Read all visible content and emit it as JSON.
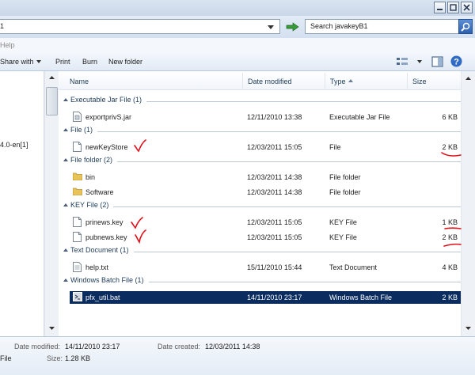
{
  "address": {
    "path_fragment": "1"
  },
  "search": {
    "text": "Search javakeyB1"
  },
  "menu": {
    "help_label": "Help"
  },
  "toolbar": {
    "share_label": "Share with",
    "print_label": "Print",
    "burn_label": "Burn",
    "new_folder_label": "New folder"
  },
  "nav": {
    "visible_item": "4.0-en[1]"
  },
  "columns": {
    "name": "Name",
    "date": "Date modified",
    "type": "Type",
    "size": "Size"
  },
  "groups": [
    {
      "title": "Executable Jar File (1)",
      "files": [
        {
          "name": "exportprivS.jar",
          "date": "12/11/2010 13:38",
          "type": "Executable Jar File",
          "size": "6 KB",
          "icon": "jar-file-icon"
        }
      ]
    },
    {
      "title": "File (1)",
      "files": [
        {
          "name": "newKeyStore",
          "date": "12/03/2011 15:05",
          "type": "File",
          "size": "2 KB",
          "icon": "blank-file-icon"
        }
      ]
    },
    {
      "title": "File folder (2)",
      "files": [
        {
          "name": "bin",
          "date": "12/03/2011 14:38",
          "type": "File folder",
          "size": "",
          "icon": "folder-icon"
        },
        {
          "name": "Software",
          "date": "12/03/2011 14:38",
          "type": "File folder",
          "size": "",
          "icon": "folder-icon"
        }
      ]
    },
    {
      "title": "KEY File (2)",
      "files": [
        {
          "name": "prinews.key",
          "date": "12/03/2011 15:05",
          "type": "KEY File",
          "size": "1 KB",
          "icon": "blank-file-icon"
        },
        {
          "name": "pubnews.key",
          "date": "12/03/2011 15:05",
          "type": "KEY File",
          "size": "2 KB",
          "icon": "blank-file-icon"
        }
      ]
    },
    {
      "title": "Text Document (1)",
      "files": [
        {
          "name": "help.txt",
          "date": "15/11/2010 15:44",
          "type": "Text Document",
          "size": "4 KB",
          "icon": "text-file-icon"
        }
      ]
    },
    {
      "title": "Windows Batch File (1)",
      "files": [
        {
          "name": "pfx_util.bat",
          "date": "14/11/2010 23:17",
          "type": "Windows Batch File",
          "size": "2 KB",
          "icon": "batch-file-icon",
          "selected": true
        }
      ]
    }
  ],
  "details": {
    "date_modified_label": "Date modified:",
    "date_modified_value": "14/11/2010 23:17",
    "date_created_label": "Date created:",
    "date_created_value": "12/03/2011 14:38",
    "type_value": "File",
    "size_label": "Size:",
    "size_value": "1.28 KB"
  },
  "colors": {
    "annotation": "#e0101a",
    "selection": "#0a2c5e",
    "header_text": "#1e3b5a"
  }
}
